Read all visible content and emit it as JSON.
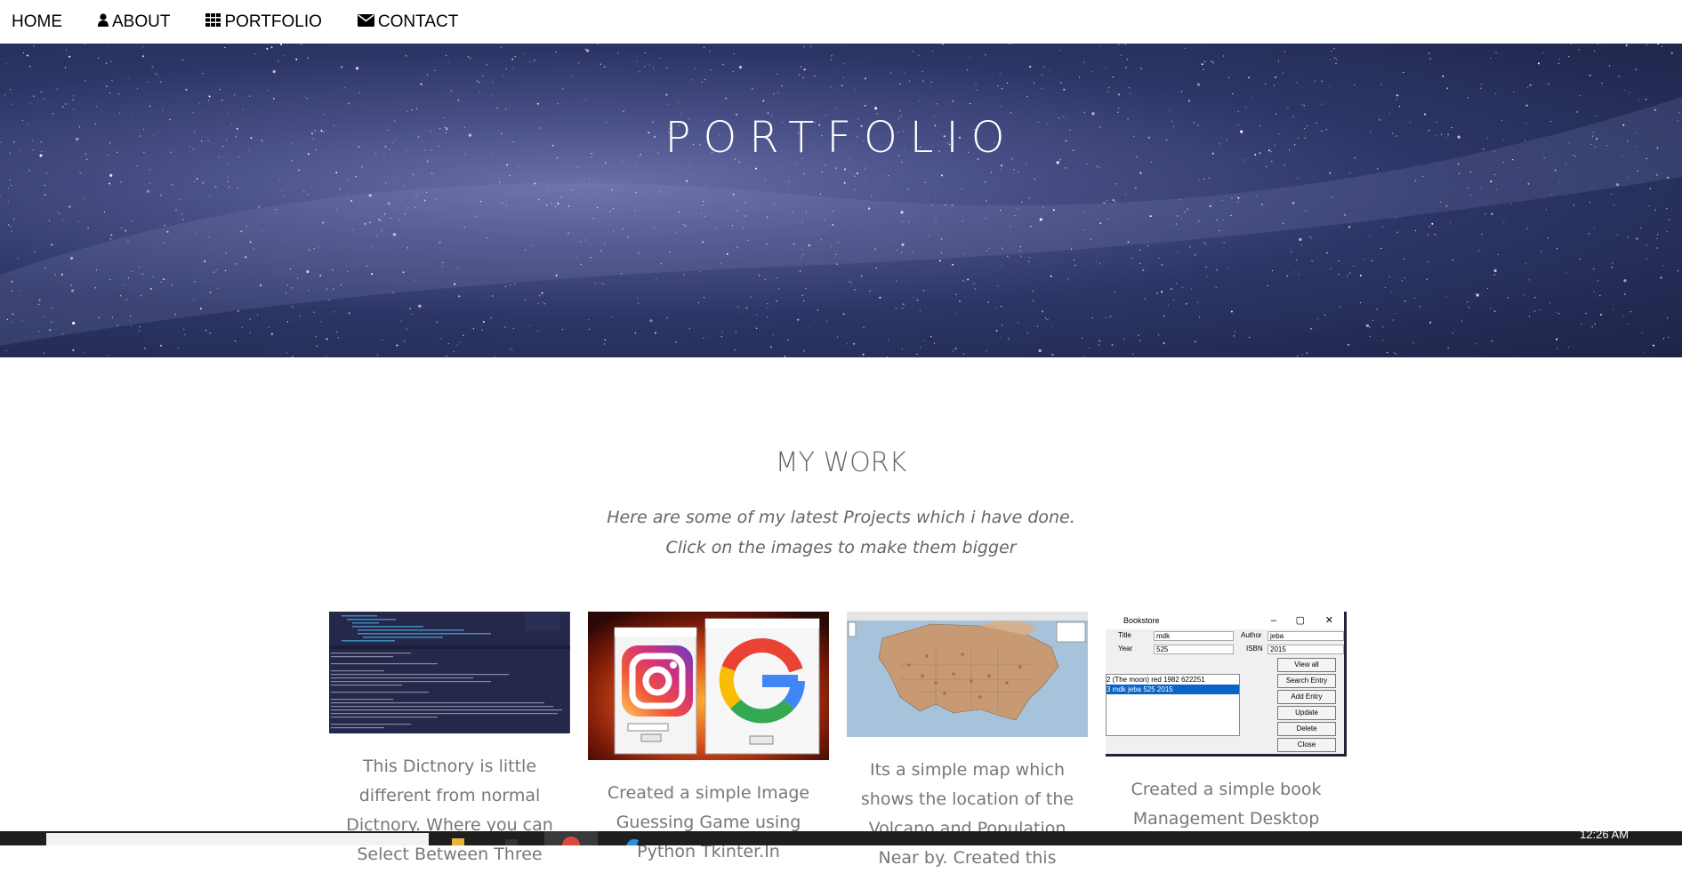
{
  "nav": {
    "items": [
      {
        "label": "HOME",
        "icon": ""
      },
      {
        "label": "ABOUT",
        "icon": "user-icon"
      },
      {
        "label": "PORTFOLIO",
        "icon": "grid-icon"
      },
      {
        "label": "CONTACT",
        "icon": "envelope-icon"
      }
    ]
  },
  "hero": {
    "title": "PORTFOLIO"
  },
  "work": {
    "title": "MY WORK",
    "subtitle_line1": "Here are some of my latest Projects which i have done.",
    "subtitle_line2": "Click on the images to make them bigger"
  },
  "projects": [
    {
      "desc": "This Dictnory is little different from normal Dictnory. Where you can Select Between Three"
    },
    {
      "desc": "Created a simple Image Guessing Game using Python Tkinter.In"
    },
    {
      "desc": "Its a simple map which shows the location of the Volcano and Population Near by. Created this"
    },
    {
      "desc": "Created a simple book Management Desktop"
    }
  ],
  "thumb_bookstore": {
    "window_title": "Bookstore",
    "title_label": "Title",
    "title_value": "mdk",
    "author_label": "Author",
    "author_value": "jeba",
    "year_label": "Year",
    "year_value": "525",
    "isbn_label": "ISBN",
    "isbn_value": "2015",
    "list": [
      "2 (The moon) red 1982 622251",
      "3 mdk jeba 525 2015"
    ],
    "buttons": [
      "View all",
      "Search Entry",
      "Add Entry",
      "Update",
      "Delete",
      "Close"
    ]
  },
  "taskbar": {
    "clock": "12:26 AM"
  },
  "colors": {
    "text_gray": "#666666",
    "hero_dark": "#1c2447",
    "taskbar": "#1f1f1f"
  }
}
